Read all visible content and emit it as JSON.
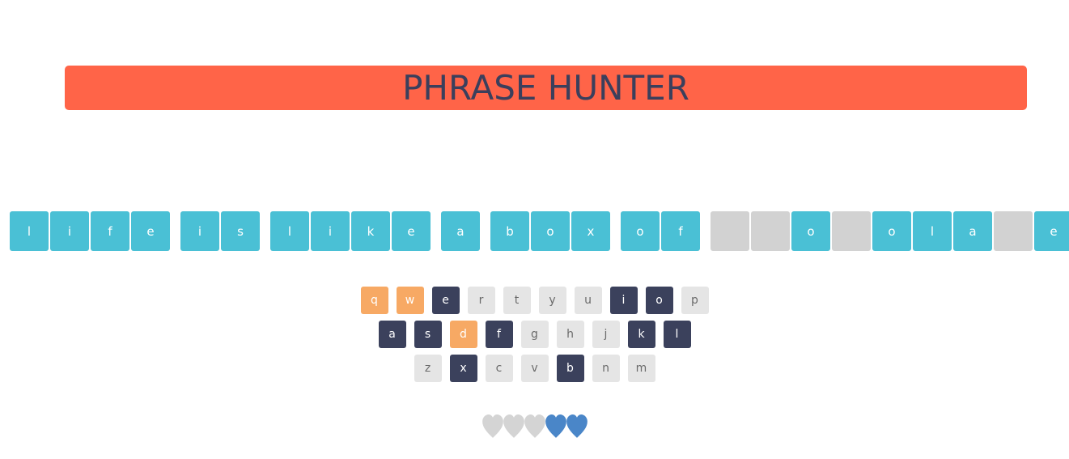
{
  "title": "PHRASE HUNTER",
  "phrase": [
    {
      "letter": "l",
      "shown": true
    },
    {
      "letter": "i",
      "shown": true
    },
    {
      "letter": "f",
      "shown": true
    },
    {
      "letter": "e",
      "shown": true
    },
    {
      "space": true
    },
    {
      "letter": "i",
      "shown": true
    },
    {
      "letter": "s",
      "shown": true
    },
    {
      "space": true
    },
    {
      "letter": "l",
      "shown": true
    },
    {
      "letter": "i",
      "shown": true
    },
    {
      "letter": "k",
      "shown": true
    },
    {
      "letter": "e",
      "shown": true
    },
    {
      "space": true
    },
    {
      "letter": "a",
      "shown": true
    },
    {
      "space": true
    },
    {
      "letter": "b",
      "shown": true
    },
    {
      "letter": "o",
      "shown": true
    },
    {
      "letter": "x",
      "shown": true
    },
    {
      "space": true
    },
    {
      "letter": "o",
      "shown": true
    },
    {
      "letter": "f",
      "shown": true
    },
    {
      "space": true
    },
    {
      "letter": "",
      "shown": false
    },
    {
      "letter": "",
      "shown": false
    },
    {
      "letter": "o",
      "shown": true
    },
    {
      "letter": "",
      "shown": false
    },
    {
      "letter": "o",
      "shown": true
    },
    {
      "letter": "l",
      "shown": true
    },
    {
      "letter": "a",
      "shown": true
    },
    {
      "letter": "",
      "shown": false
    },
    {
      "letter": "e",
      "shown": true
    }
  ],
  "keyboard": {
    "rows": [
      [
        {
          "key": "q",
          "state": "wrong"
        },
        {
          "key": "w",
          "state": "wrong"
        },
        {
          "key": "e",
          "state": "chosen"
        },
        {
          "key": "r",
          "state": "unused"
        },
        {
          "key": "t",
          "state": "unused"
        },
        {
          "key": "y",
          "state": "unused"
        },
        {
          "key": "u",
          "state": "unused"
        },
        {
          "key": "i",
          "state": "chosen"
        },
        {
          "key": "o",
          "state": "chosen"
        },
        {
          "key": "p",
          "state": "unused"
        }
      ],
      [
        {
          "key": "a",
          "state": "chosen"
        },
        {
          "key": "s",
          "state": "chosen"
        },
        {
          "key": "d",
          "state": "wrong"
        },
        {
          "key": "f",
          "state": "chosen"
        },
        {
          "key": "g",
          "state": "unused"
        },
        {
          "key": "h",
          "state": "unused"
        },
        {
          "key": "j",
          "state": "unused"
        },
        {
          "key": "k",
          "state": "chosen"
        },
        {
          "key": "l",
          "state": "chosen"
        }
      ],
      [
        {
          "key": "z",
          "state": "unused"
        },
        {
          "key": "x",
          "state": "chosen"
        },
        {
          "key": "c",
          "state": "unused"
        },
        {
          "key": "v",
          "state": "unused"
        },
        {
          "key": "b",
          "state": "chosen"
        },
        {
          "key": "n",
          "state": "unused"
        },
        {
          "key": "m",
          "state": "unused"
        }
      ]
    ]
  },
  "lives": {
    "total": 5,
    "remaining": 2,
    "icon": "heart-icon",
    "lost_color": "#d4d4d4",
    "live_color": "#4a86c8"
  },
  "colors": {
    "banner": "#ff6448",
    "title_text": "#3b3f5c",
    "tile_shown": "#4ac0d5",
    "tile_hidden": "#d2d2d2",
    "key_chosen": "#3b415c",
    "key_wrong": "#f7a964",
    "key_unused": "#e5e5e5"
  }
}
